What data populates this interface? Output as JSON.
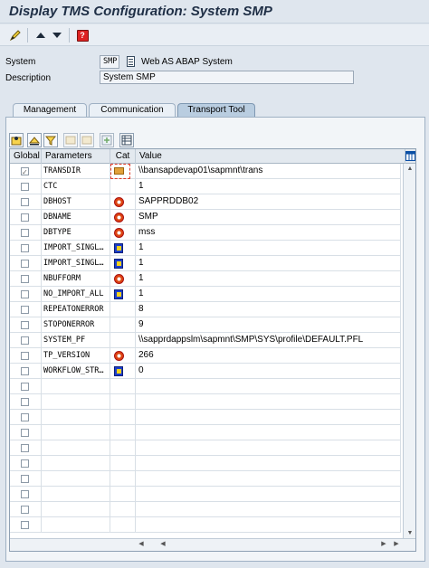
{
  "window": {
    "title": "Display TMS Configuration: System SMP"
  },
  "toolbar": {
    "edit_icon": "edit-icon",
    "up_icon": "arrow-up-icon",
    "down_icon": "arrow-down-icon",
    "help_icon": "help-icon"
  },
  "form": {
    "system_label": "System",
    "system_value": "SMP",
    "system_type": "Web AS ABAP System",
    "description_label": "Description",
    "description_value": "System SMP"
  },
  "tabs": [
    {
      "label": "Management"
    },
    {
      "label": "Communication"
    },
    {
      "label": "Transport Tool"
    }
  ],
  "table": {
    "headers": {
      "global": "Global",
      "parameters": "Parameters",
      "cat": "Cat",
      "value": "Value"
    },
    "rows": [
      {
        "checked": true,
        "param": "TRANSDIR",
        "cat": "folder",
        "value": "\\\\bansapdevap01\\sapmnt\\trans"
      },
      {
        "checked": false,
        "param": "CTC",
        "cat": "",
        "value": "1"
      },
      {
        "checked": false,
        "param": "DBHOST",
        "cat": "red",
        "value": "SAPPRDDB02"
      },
      {
        "checked": false,
        "param": "DBNAME",
        "cat": "red",
        "value": "SMP"
      },
      {
        "checked": false,
        "param": "DBTYPE",
        "cat": "red",
        "value": "mss"
      },
      {
        "checked": false,
        "param": "IMPORT_SINGL…",
        "cat": "blue",
        "value": "1"
      },
      {
        "checked": false,
        "param": "IMPORT_SINGL…",
        "cat": "blue",
        "value": "1"
      },
      {
        "checked": false,
        "param": "NBUFFORM",
        "cat": "red",
        "value": "1"
      },
      {
        "checked": false,
        "param": "NO_IMPORT_ALL",
        "cat": "blue",
        "value": "1"
      },
      {
        "checked": false,
        "param": "REPEATONERROR",
        "cat": "",
        "value": "8"
      },
      {
        "checked": false,
        "param": "STOPONERROR",
        "cat": "",
        "value": "9"
      },
      {
        "checked": false,
        "param": "SYSTEM_PF",
        "cat": "",
        "value": "\\\\sapprdappslm\\sapmnt\\SMP\\SYS\\profile\\DEFAULT.PFL"
      },
      {
        "checked": false,
        "param": "TP_VERSION",
        "cat": "red",
        "value": "266"
      },
      {
        "checked": false,
        "param": "WORKFLOW_STR…",
        "cat": "blue",
        "value": "0"
      }
    ]
  }
}
